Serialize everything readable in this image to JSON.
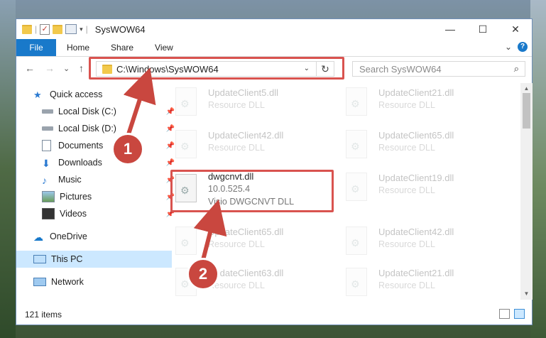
{
  "window": {
    "title": "SysWOW64",
    "minimize": "—",
    "maximize": "☐",
    "close": "✕"
  },
  "ribbon": {
    "tabs": [
      "File",
      "Home",
      "Share",
      "View"
    ],
    "expand": "⌄",
    "help": "?"
  },
  "nav": {
    "back": "←",
    "forward": "→",
    "recent": "⌄",
    "up": "↑",
    "address": "C:\\Windows\\SysWOW64",
    "address_dropdown": "⌄",
    "refresh": "↻",
    "search_placeholder": "Search SysWOW64",
    "search_icon": "⌕"
  },
  "sidebar": {
    "items": [
      {
        "label": "Quick access",
        "icon": "star-icon",
        "pinned": false
      },
      {
        "label": "Local Disk (C:)",
        "icon": "drive-icon",
        "pinned": true
      },
      {
        "label": "Local Disk (D:)",
        "icon": "drive-icon",
        "pinned": true
      },
      {
        "label": "Documents",
        "icon": "documents-icon",
        "pinned": true
      },
      {
        "label": "Downloads",
        "icon": "download-icon",
        "pinned": true
      },
      {
        "label": "Music",
        "icon": "music-icon",
        "pinned": true
      },
      {
        "label": "Pictures",
        "icon": "pictures-icon",
        "pinned": true
      },
      {
        "label": "Videos",
        "icon": "videos-icon",
        "pinned": true
      },
      {
        "label": "OneDrive",
        "icon": "cloud-icon",
        "pinned": false
      },
      {
        "label": "This PC",
        "icon": "computer-icon",
        "pinned": false
      },
      {
        "label": "Network",
        "icon": "network-icon",
        "pinned": false
      }
    ],
    "pin_glyph": "📌"
  },
  "files": {
    "left": [
      {
        "name": "UpdateClient5.dll",
        "type": "Resource DLL"
      },
      {
        "name": "UpdateClient42.dll",
        "type": "Resource DLL"
      },
      {
        "name": "dwgcnvt.dll",
        "version": "10.0.525.4",
        "type": "Visio DWGCNVT DLL"
      },
      {
        "name": "UpdateClient65.dll",
        "type": "Resource DLL"
      },
      {
        "name": "UpdateClient63.dll",
        "type": "Resource DLL"
      }
    ],
    "right": [
      {
        "name": "UpdateClient21.dll",
        "type": "Resource DLL"
      },
      {
        "name": "UpdateClient65.dll",
        "type": "Resource DLL"
      },
      {
        "name": "UpdateClient19.dll",
        "type": "Resource DLL"
      },
      {
        "name": "UpdateClient42.dll",
        "type": "Resource DLL"
      },
      {
        "name": "UpdateClient21.dll",
        "type": "Resource DLL"
      }
    ]
  },
  "status": {
    "item_count": "121 items"
  },
  "annotations": {
    "step1": "1",
    "step2": "2",
    "color": "#c9473f"
  }
}
